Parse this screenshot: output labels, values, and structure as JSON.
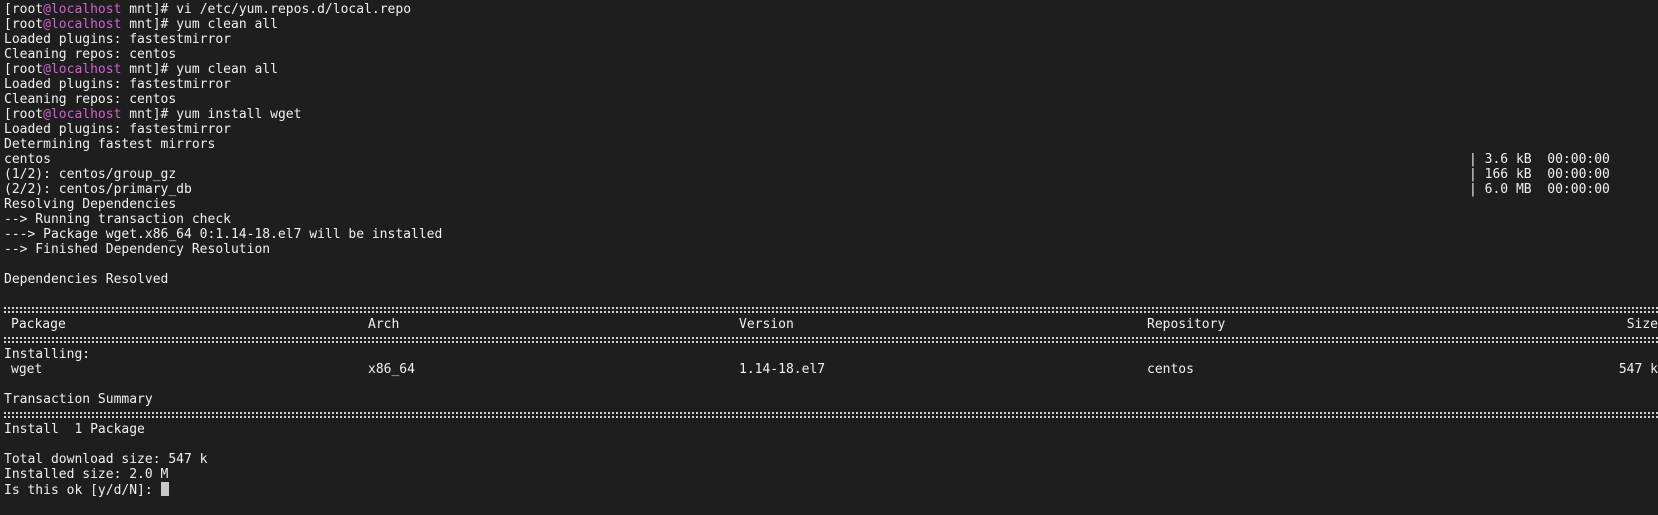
{
  "prompt": {
    "user": "root",
    "at": "@",
    "host": "localhost",
    "dir": "mnt"
  },
  "lines": {
    "cmd1": "vi /etc/yum.repos.d/local.repo",
    "cmd2": "yum clean all",
    "plugins": "Loaded plugins: fastestmirror",
    "cleaning": "Cleaning repos: centos",
    "cmd3": "yum clean all",
    "plugins2": "Loaded plugins: fastestmirror",
    "cleaning2": "Cleaning repos: centos",
    "cmd4": "yum install wget",
    "plugins3": "Loaded plugins: fastestmirror",
    "determining": "Determining fastest mirrors",
    "resolving": "Resolving Dependencies",
    "check": "--> Running transaction check",
    "package_line": "---> Package wget.x86_64 0:1.14-18.el7 will be installed",
    "finished": "--> Finished Dependency Resolution",
    "deps_resolved": "Dependencies Resolved",
    "installing": "Installing:",
    "tx_summary": "Transaction Summary",
    "install_count": "Install  1 Package",
    "total_dl": "Total download size: 547 k",
    "installed_size": "Installed size: 2.0 M",
    "confirm": "Is this ok [y/d/N]: "
  },
  "downloads": [
    {
      "name": "centos",
      "info": "| 3.6 kB  00:00:00"
    },
    {
      "name": "(1/2): centos/group_gz",
      "info": "| 166 kB  00:00:00"
    },
    {
      "name": "(2/2): centos/primary_db",
      "info": "| 6.0 MB  00:00:00"
    }
  ],
  "table": {
    "headers": {
      "package": "Package",
      "arch": "Arch",
      "version": "Version",
      "repository": "Repository",
      "size": "Size"
    },
    "row": {
      "package": "wget",
      "arch": "x86_64",
      "version": "1.14-18.el7",
      "repository": "centos",
      "size": "547 k"
    }
  },
  "colors": {
    "background": "#1e1e1e",
    "text": "#f0f0f0",
    "hostname": "#d45fd4"
  }
}
